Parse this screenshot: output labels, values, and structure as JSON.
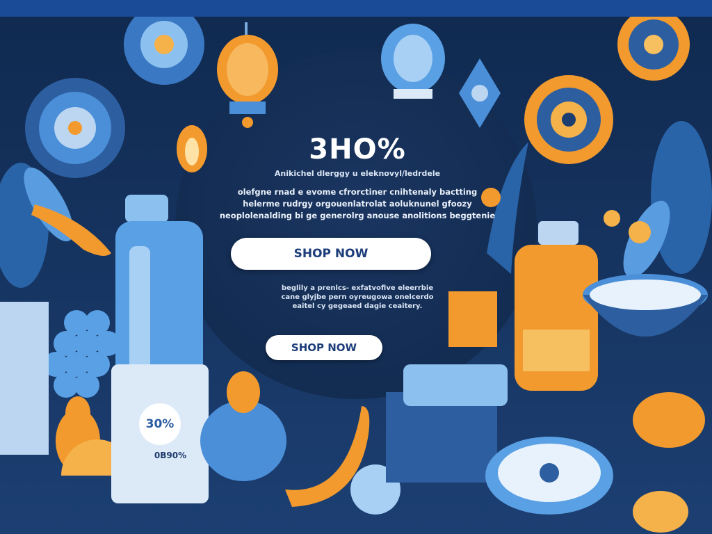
{
  "promo": {
    "headline": "3HO%",
    "subheadline": "Anikichel dlerggy u eleknovyl/ledrdele",
    "description_lines": [
      "olefgne rnad e evome cfrorctiner cnihtenaly bactting",
      "helerme rudrgy orgouenlatrolat aoluknunel gfoozy",
      "neoplolenalding bi ge generolrg anouse anolitions beggtenie"
    ],
    "primary_button_label": "SHOP NOW",
    "description2_lines": [
      "beglily a prenlcs- exfatvofive eleerrbie",
      "cane glyjbe pern oyreugowa onelcerdo",
      "eaitel cy gegeaed dagie ceaitery."
    ],
    "secondary_button_label": "SHOP NOW"
  },
  "package": {
    "badge_text": "30%",
    "label_text": "0B90%"
  },
  "colors": {
    "background": "#14305a",
    "accent_blue": "#4a8fd8",
    "accent_orange": "#f29a2e",
    "button_text": "#1d3e7a"
  }
}
